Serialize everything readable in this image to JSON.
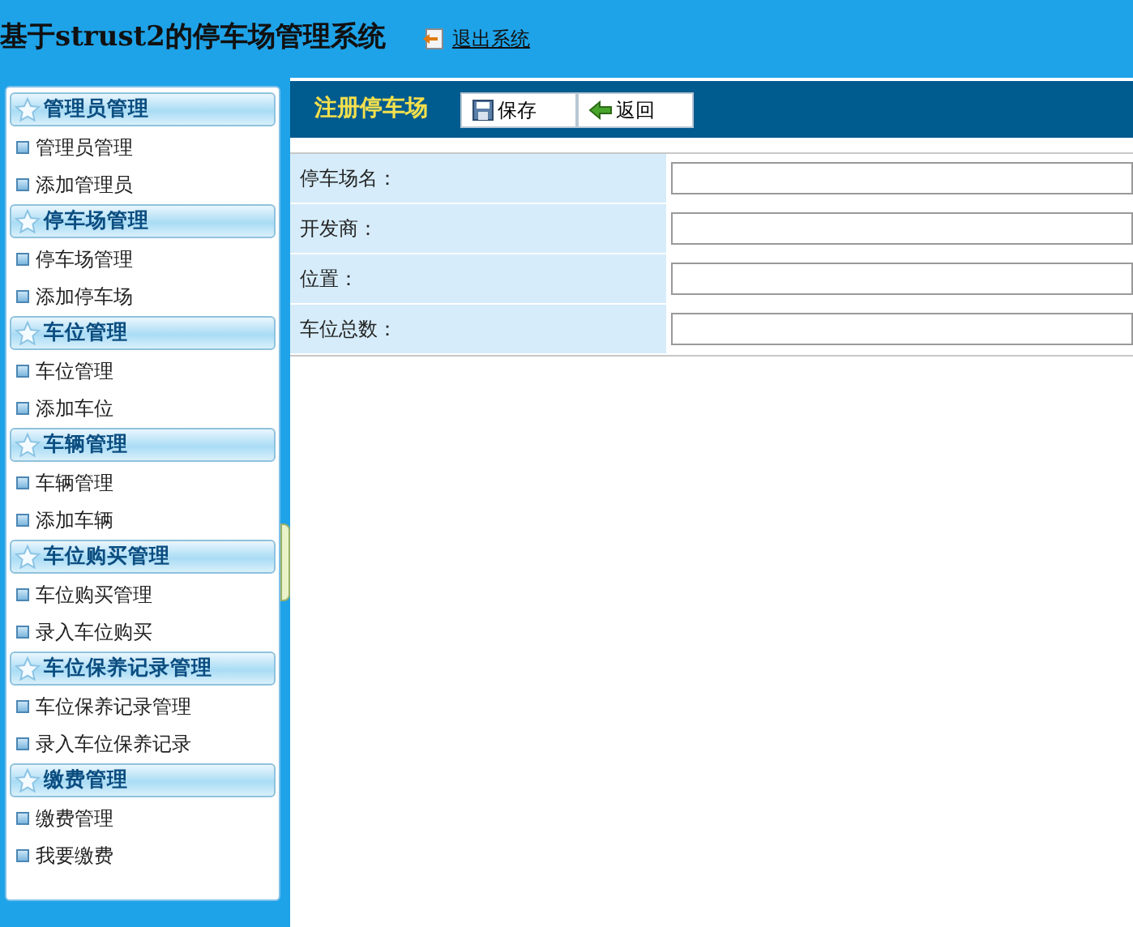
{
  "header": {
    "title": "基于strust2的停车场管理系统",
    "logout": "退出系统"
  },
  "sidebar": {
    "groups": [
      {
        "title": "管理员管理",
        "items": [
          "管理员管理",
          "添加管理员"
        ]
      },
      {
        "title": "停车场管理",
        "items": [
          "停车场管理",
          "添加停车场"
        ]
      },
      {
        "title": "车位管理",
        "items": [
          "车位管理",
          "添加车位"
        ]
      },
      {
        "title": "车辆管理",
        "items": [
          "车辆管理",
          "添加车辆"
        ]
      },
      {
        "title": "车位购买管理",
        "items": [
          "车位购买管理",
          "录入车位购买"
        ]
      },
      {
        "title": "车位保养记录管理",
        "items": [
          "车位保养记录管理",
          "录入车位保养记录"
        ]
      },
      {
        "title": "缴费管理",
        "items": [
          "缴费管理",
          "我要缴费"
        ]
      }
    ]
  },
  "main": {
    "title": "注册停车场",
    "buttons": [
      {
        "kind": "save",
        "label": "保存"
      },
      {
        "kind": "back",
        "label": "返回"
      }
    ],
    "fields": [
      {
        "label": "停车场名："
      },
      {
        "label": "开发商："
      },
      {
        "label": "位置："
      },
      {
        "label": "车位总数："
      }
    ]
  }
}
